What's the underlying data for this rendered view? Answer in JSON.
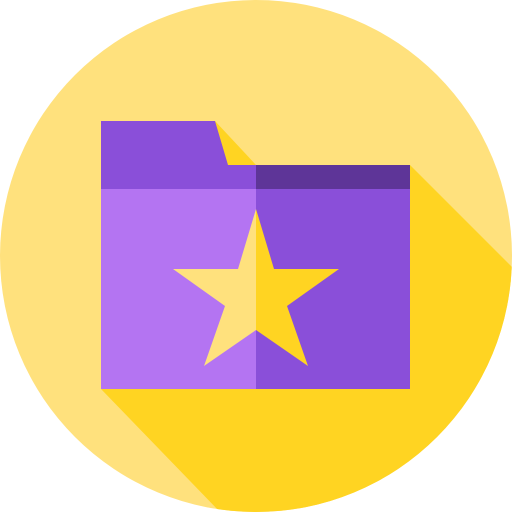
{
  "icon": {
    "name": "starred-folder-icon",
    "style": "flat circle with long shadow",
    "colors": {
      "circle_background": "#FFE17D",
      "long_shadow": "#FFD422",
      "folder_tab": "#8A4FD9",
      "folder_back_left": "#8A4FD9",
      "folder_back_right": "#5E3598",
      "folder_front_left": "#B474F2",
      "folder_front_right": "#8A4FD9",
      "star_left": "#FFE17D",
      "star_right": "#FFD422"
    }
  }
}
